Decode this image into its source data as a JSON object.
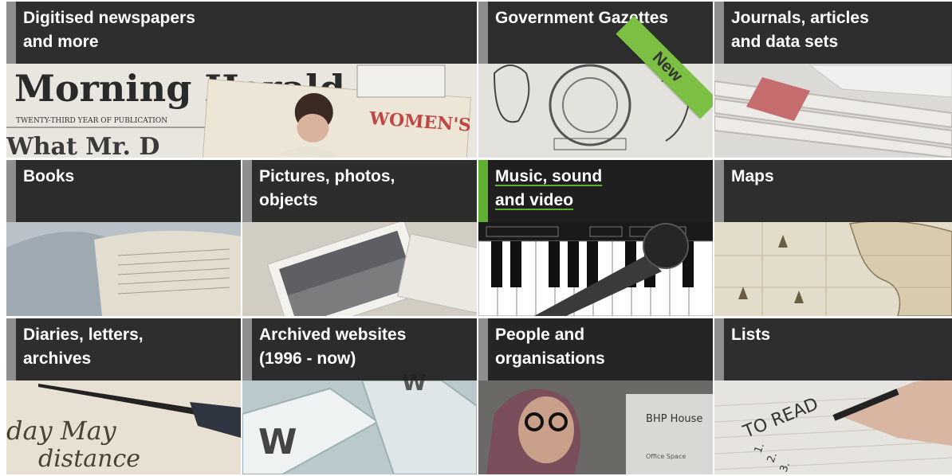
{
  "tiles": [
    {
      "label": "Digitised newspapers\nand more",
      "accent": "#8e8e8e"
    },
    {
      "label": "Government Gazettes",
      "accent": "#8e8e8e",
      "badge": "New"
    },
    {
      "label": "Journals, articles\nand data sets",
      "accent": "#8e8e8e"
    },
    {
      "label": "Books",
      "accent": "#8e8e8e"
    },
    {
      "label": "Pictures, photos,\nobjects",
      "accent": "#8e8e8e"
    },
    {
      "label": "Music, sound\nand video",
      "accent": "#5fb030",
      "active": true
    },
    {
      "label": "Maps",
      "accent": "#8e8e8e"
    },
    {
      "label": "Diaries, letters,\narchives",
      "accent": "#8e8e8e"
    },
    {
      "label": "Archived websites\n(1996 - now)",
      "accent": "#8e8e8e"
    },
    {
      "label": "People and\norganisations",
      "accent": "#8e8e8e"
    },
    {
      "label": "Lists",
      "accent": "#8e8e8e"
    }
  ],
  "images": {
    "newspapers": {
      "masthead": "Morning Herald.",
      "subline": "TWENTY-THIRD YEAR OF PUBLICATION",
      "magazine": "WOMEN'S WEEKLY",
      "fragment": "What Mr. D"
    },
    "diaries": {
      "script1": "day May",
      "script2": "distance"
    },
    "websites": {
      "key_letter": "W"
    },
    "people": {
      "sign": "BHP House",
      "sign2": "Office Space"
    },
    "lists": {
      "note": "TO READ",
      "items": [
        "1.",
        "2.",
        "3."
      ]
    }
  }
}
